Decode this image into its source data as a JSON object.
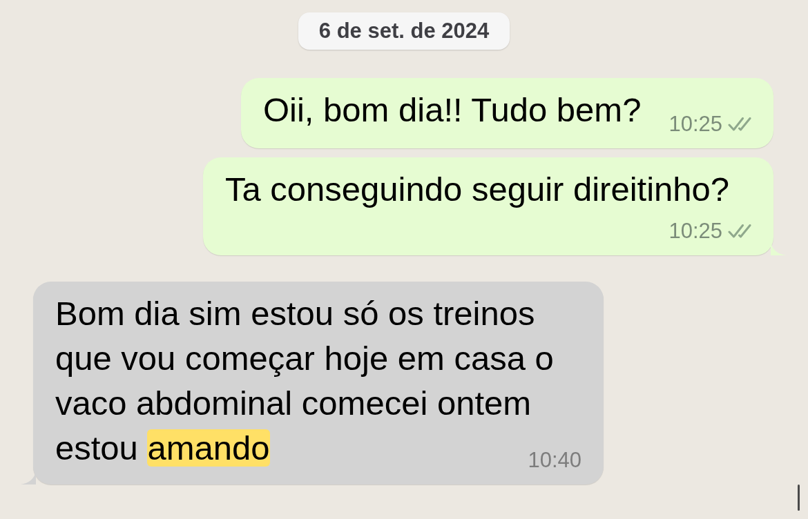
{
  "date_chip": {
    "label": "6 de set. de 2024"
  },
  "messages": [
    {
      "kind": "outgoing",
      "parts": [
        {
          "text": "Oii, bom dia!! Tudo bem?",
          "highlighted": false
        }
      ],
      "time": "10:25",
      "read": false,
      "tail": false
    },
    {
      "kind": "outgoing",
      "parts": [
        {
          "text": "Ta conseguindo seguir direitinho?",
          "highlighted": false
        }
      ],
      "time": "10:25",
      "read": false,
      "tail": true
    },
    {
      "kind": "incoming",
      "parts": [
        {
          "text": "Bom dia sim estou só os treinos que vou começar hoje em casa o vaco abdominal comecei ontem estou ",
          "highlighted": false
        },
        {
          "text": "amando",
          "highlighted": true
        }
      ],
      "time": "10:40",
      "tail": true
    }
  ]
}
